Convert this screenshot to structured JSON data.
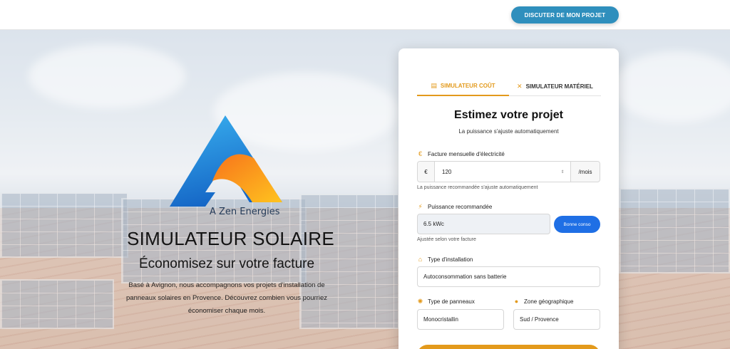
{
  "header": {
    "cta_label": "DISCUTER DE MON PROJET"
  },
  "hero": {
    "logo_text": "A Zen Energies",
    "title": "SIMULATEUR SOLAIRE",
    "subtitle": "Économisez sur votre facture",
    "description": "Basé à Avignon, nous accompagnons vos projets d'installation de panneaux solaires en Provence. Découvrez combien vous pourriez économiser chaque mois."
  },
  "card": {
    "tabs": [
      {
        "label": "SIMULATEUR COÛT",
        "icon": "calculator-icon",
        "active": true
      },
      {
        "label": "SIMULATEUR MATÉRIEL",
        "icon": "tools-icon",
        "active": false
      }
    ],
    "title": "Estimez votre projet",
    "subtitle": "La puissance s'ajuste automatiquement",
    "bill": {
      "label": "Facture mensuelle d'électricité",
      "prefix": "€",
      "value": "120",
      "suffix": "/mois",
      "hint": "La puissance recommandée s'ajuste automatiquement"
    },
    "power": {
      "label": "Puissance recommandée",
      "value": "6.5 kWc",
      "button": "Bonne conso",
      "hint": "Ajustée selon votre facture"
    },
    "installation": {
      "label": "Type d'installation",
      "value": "Autoconsommation sans batterie"
    },
    "panels": {
      "label": "Type de panneaux",
      "value": "Monocristallin"
    },
    "zone": {
      "label": "Zone géographique",
      "value": "Sud / Provence"
    }
  },
  "colors": {
    "accent": "#e39a1c",
    "cta": "#2f8fbd",
    "primary_button": "#1f6fe5",
    "logo_blue": "#1c86d8",
    "logo_orange": "#f39a1e"
  }
}
